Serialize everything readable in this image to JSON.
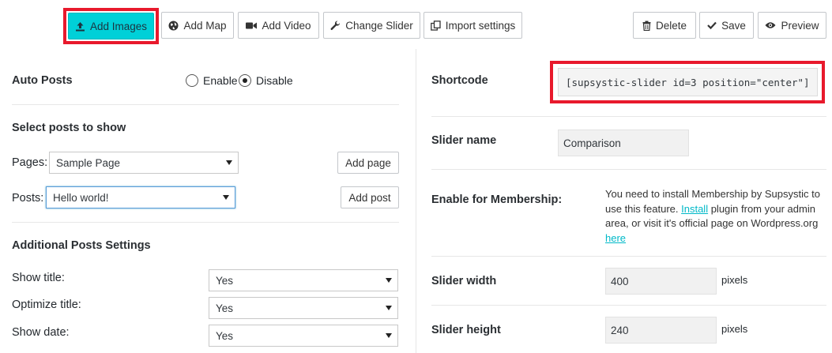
{
  "toolbar": {
    "add_images": "Add Images",
    "add_map": "Add Map",
    "add_video": "Add Video",
    "change_slider": "Change Slider",
    "import_settings": "Import settings",
    "delete": "Delete",
    "save": "Save",
    "preview": "Preview"
  },
  "auto_posts": {
    "label": "Auto Posts",
    "option_enable": "Enable",
    "option_disable": "Disable",
    "selected": "Disable"
  },
  "select_posts": {
    "heading": "Select posts to show",
    "pages_label": "Pages:",
    "pages_value": "Sample Page",
    "add_page": "Add page",
    "posts_label": "Posts:",
    "posts_value": "Hello world!",
    "add_post": "Add post"
  },
  "additional": {
    "heading": "Additional Posts Settings",
    "rows": [
      {
        "label": "Show title:",
        "value": "Yes"
      },
      {
        "label": "Optimize title:",
        "value": "Yes"
      },
      {
        "label": "Show date:",
        "value": "Yes"
      }
    ]
  },
  "right": {
    "shortcode_label": "Shortcode",
    "shortcode_value": "[supsystic-slider id=3 position=\"center\"]",
    "slider_name_label": "Slider name",
    "slider_name_value": "Comparison",
    "membership_label": "Enable for Membership:",
    "membership_text_1": "You need to install Membership by Supsystic to use this feature. ",
    "membership_link_install": "Install",
    "membership_text_2": " plugin from your admin area, or visit it's official page on Wordpress.org ",
    "membership_link_here": "here",
    "width_label": "Slider width",
    "width_value": "400",
    "width_unit": "pixels",
    "height_label": "Slider height",
    "height_value": "240",
    "height_unit": "pixels"
  },
  "colors": {
    "accent": "#00d0d8",
    "highlight": "#e8192c",
    "link": "#00b9c8"
  },
  "icons": [
    "upload-icon",
    "globe-icon",
    "video-camera-icon",
    "wrench-icon",
    "import-icon",
    "trash-icon",
    "check-icon",
    "eye-icon"
  ]
}
